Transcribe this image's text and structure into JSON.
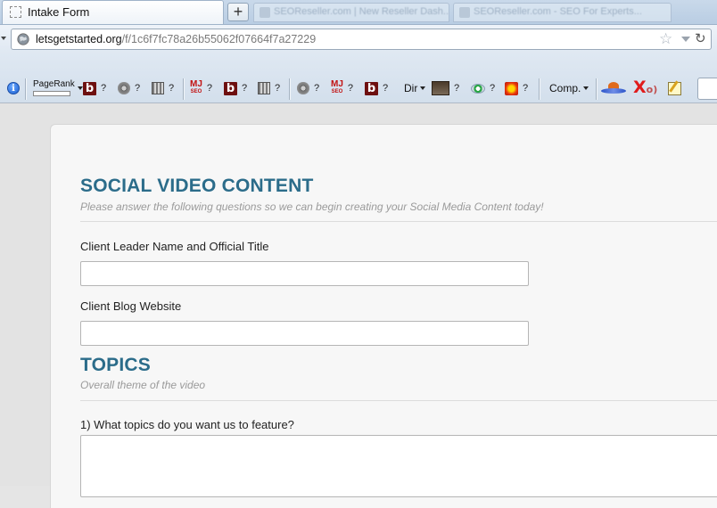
{
  "browser": {
    "active_tab": {
      "title": "Intake Form"
    },
    "new_tab_label": "+",
    "background_tabs": [
      {
        "title": "SEOReseller.com | New Reseller Dash..."
      },
      {
        "title": "SEOReseller.com - SEO For Experts..."
      }
    ],
    "url": {
      "host": "letsgetstarted.org",
      "path": "/f/1c6f7fc78a26b55062f07664f7a27229"
    }
  },
  "toolbar": {
    "pagerank_label": "PageRank",
    "question_mark": "?",
    "dir_label": "Dir",
    "comp_label": "Comp.",
    "mj_top": "MJ",
    "mj_bottom": "SEO",
    "b_letter": "b",
    "info_letter": "i",
    "x_letter": "X",
    "x_suffix": "o)"
  },
  "form": {
    "section1": {
      "title": "SOCIAL VIDEO CONTENT",
      "subtitle": "Please answer the following questions so we can begin creating your Social Media Content today!"
    },
    "fields": [
      {
        "label": "Client Leader Name and Official Title",
        "value": ""
      },
      {
        "label": "Client Blog Website",
        "value": ""
      }
    ],
    "section2": {
      "title": "TOPICS",
      "subtitle": "Overall theme of the video"
    },
    "question1": {
      "label": "1) What topics do you want us to feature?",
      "value": ""
    }
  }
}
